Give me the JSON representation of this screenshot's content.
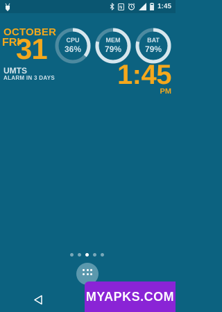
{
  "status_bar": {
    "time": "1:45",
    "icons": [
      "android-debug-icon",
      "bluetooth-icon",
      "nfc-icon",
      "alarm-icon",
      "signal-icon",
      "battery-icon"
    ]
  },
  "date_widget": {
    "month": "OCTOBER",
    "weekday": "FRI",
    "day": "31",
    "network": "UMTS",
    "alarm": "ALARM IN 3 DAYS"
  },
  "gauges": [
    {
      "label": "CPU",
      "value": "36%",
      "fraction": 0.36
    },
    {
      "label": "MEM",
      "value": "79%",
      "fraction": 0.79
    },
    {
      "label": "BAT",
      "value": "79%",
      "fraction": 0.79
    }
  ],
  "clock": {
    "time": "1:45",
    "ampm": "PM"
  },
  "home": {
    "page_count": 5,
    "active_page": 3
  },
  "watermark": {
    "text": "MYAPKS.COM"
  },
  "colors": {
    "background": "#0c6280",
    "accent": "#f4a81d",
    "gauge_fill": "#d6e6ed",
    "gauge_track": "#4d8aa0",
    "watermark": "#8a24d6"
  }
}
